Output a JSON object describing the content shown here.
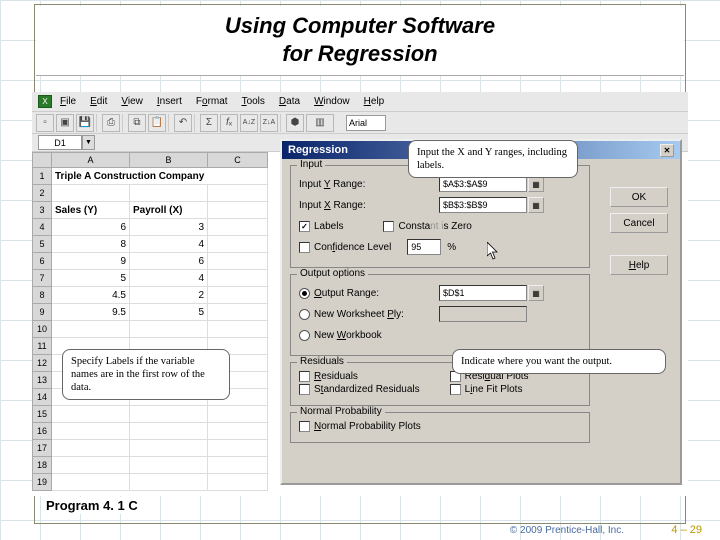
{
  "title": {
    "line1": "Using Computer Software",
    "line2": "for Regression"
  },
  "menubar": {
    "items": [
      "File",
      "Edit",
      "View",
      "Insert",
      "Format",
      "Tools",
      "Data",
      "Window",
      "Help"
    ]
  },
  "toolbar": {
    "font": "Arial"
  },
  "namebox": "D1",
  "columns": [
    "A",
    "B",
    "C"
  ],
  "rows": [
    "1",
    "2",
    "3",
    "4",
    "5",
    "6",
    "7",
    "8",
    "9",
    "10",
    "11",
    "12",
    "13",
    "14",
    "15",
    "16",
    "17",
    "18",
    "19"
  ],
  "sheet": {
    "a1": "Triple A Construction Company",
    "a3": "Sales (Y)",
    "b3": "Payroll (X)",
    "data": [
      {
        "y": "6",
        "x": "3"
      },
      {
        "y": "8",
        "x": "4"
      },
      {
        "y": "9",
        "x": "6"
      },
      {
        "y": "5",
        "x": "4"
      },
      {
        "y": "4.5",
        "x": "2"
      },
      {
        "y": "9.5",
        "x": "5"
      }
    ]
  },
  "dialog": {
    "title": "Regression",
    "groups": {
      "input": "Input",
      "output": "Output options",
      "residuals": "Residuals",
      "normal": "Normal Probability"
    },
    "labels": {
      "yrange": "Input Y Range:",
      "xrange": "Input X Range:",
      "labels": "Labels",
      "constzero": "Constant is Zero",
      "conflevel": "Confidence Level",
      "pct": "%",
      "outrange": "Output Range:",
      "newply": "New Worksheet Ply:",
      "newwb": "New Workbook",
      "residuals": "Residuals",
      "stdres": "Standardized Residuals",
      "resplots": "Residual Plots",
      "lineplots": "Line Fit Plots",
      "normprob": "Normal Probability Plots"
    },
    "values": {
      "yrange": "$A$3:$A$9",
      "xrange": "$B$3:$B$9",
      "conflevel": "95",
      "outrange": "$D$1"
    },
    "buttons": {
      "ok": "OK",
      "cancel": "Cancel",
      "help": "Help"
    }
  },
  "callouts": {
    "c1": "Input the X and Y ranges, including labels.",
    "c2": "Specify Labels if the variable names are in the first row of the data.",
    "c3": "Indicate where you want the output."
  },
  "footer": {
    "program": "Program 4. 1 C",
    "copyright": "© 2009 Prentice-Hall, Inc.",
    "page": "4 – 29"
  }
}
